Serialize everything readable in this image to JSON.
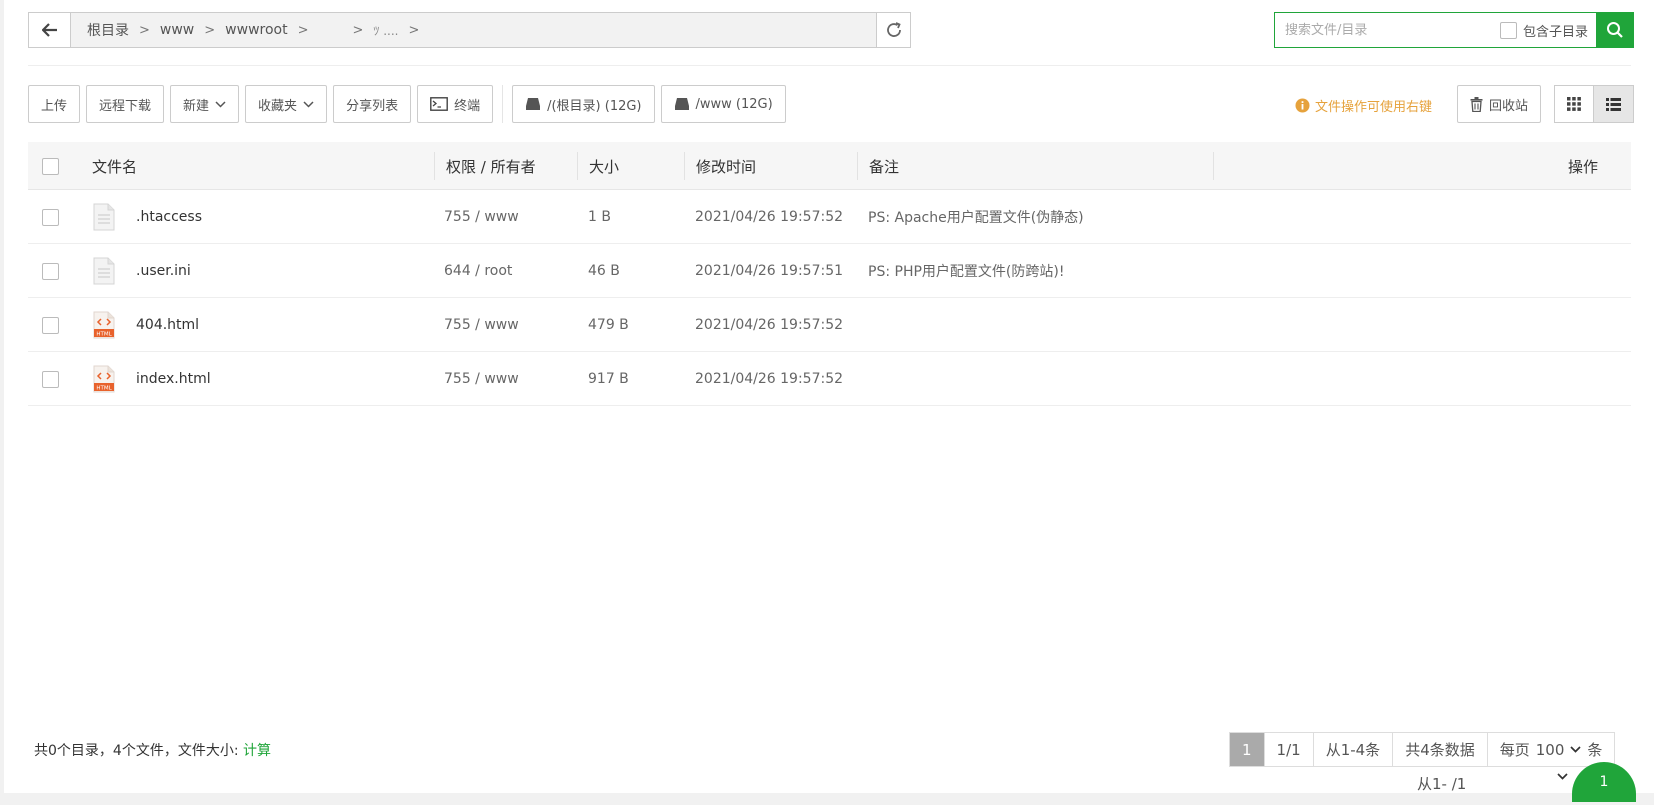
{
  "breadcrumb": {
    "items": [
      "根目录",
      "www",
      "wwwroot",
      "",
      "ﾂ ...."
    ]
  },
  "search": {
    "placeholder": "搜索文件/目录",
    "include_subdir_label": "包含子目录"
  },
  "toolbar": {
    "upload": "上传",
    "remote_download": "远程下载",
    "new": "新建",
    "favorites": "收藏夹",
    "share_list": "分享列表",
    "terminal": "终端",
    "disk_root": "/(根目录) (12G)",
    "disk_www": "/www (12G)",
    "tip": "文件操作可使用右键",
    "recycle_bin": "回收站"
  },
  "table": {
    "headers": {
      "name": "文件名",
      "perm": "权限 / 所有者",
      "size": "大小",
      "mtime": "修改时间",
      "note": "备注",
      "action": "操作"
    },
    "rows": [
      {
        "name": ".htaccess",
        "perm": "755 / www",
        "size": "1 B",
        "mtime": "2021/04/26 19:57:52",
        "note": "PS: Apache用户配置文件(伪静态)",
        "icon": "file-icon"
      },
      {
        "name": ".user.ini",
        "perm": "644 / root",
        "size": "46 B",
        "mtime": "2021/04/26 19:57:51",
        "note": "PS: PHP用户配置文件(防跨站)!",
        "icon": "file-icon"
      },
      {
        "name": "404.html",
        "perm": "755 / www",
        "size": "479 B",
        "mtime": "2021/04/26 19:57:52",
        "note": "",
        "icon": "html-file-icon"
      },
      {
        "name": "index.html",
        "perm": "755 / www",
        "size": "917 B",
        "mtime": "2021/04/26 19:57:52",
        "note": "",
        "icon": "html-file-icon"
      }
    ],
    "html_badge": "HTML"
  },
  "footer": {
    "summary": "共0个目录，4个文件，文件大小: ",
    "calc": "计算",
    "pager": {
      "current": "1",
      "pages": "1/1",
      "range": "从1-4条",
      "total": "共4条数据",
      "per_page_label": "每页",
      "per_page_value": "100",
      "unit": "条"
    },
    "second_line": "从1- /1",
    "fab_text": "1"
  },
  "colors": {
    "accent": "#20a53a",
    "tip": "#e6a23c",
    "html_icon": "#e8622c"
  }
}
